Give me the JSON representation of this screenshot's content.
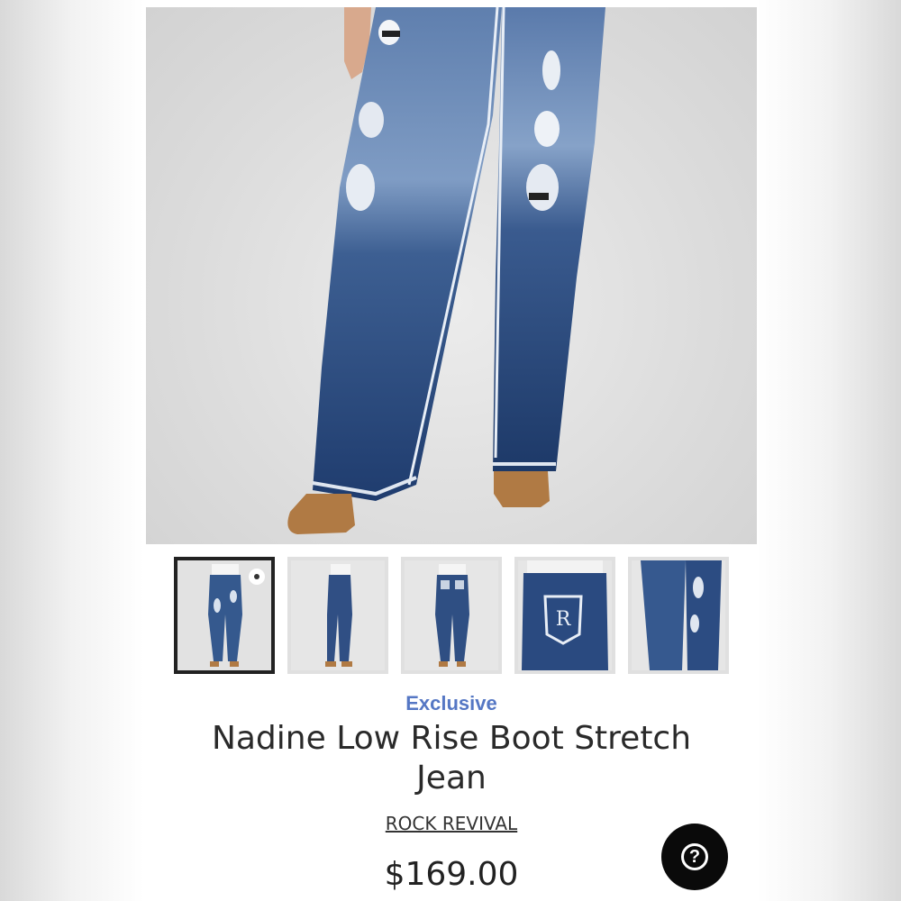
{
  "product": {
    "badge": "Exclusive",
    "title": "Nadine Low Rise Boot Stretch Jean",
    "brand": "ROCK REVIVAL",
    "price": "$169.00"
  },
  "gallery": {
    "main_image": "jeans-front-view-image",
    "selected_index": 0,
    "thumbnails": [
      {
        "view": "front-full"
      },
      {
        "view": "side-full"
      },
      {
        "view": "back-full"
      },
      {
        "view": "back-pocket-detail"
      },
      {
        "view": "leg-detail"
      }
    ]
  },
  "help": {
    "icon": "question-icon",
    "glyph": "?"
  },
  "colors": {
    "denim_dark": "#1f3c6e",
    "denim_mid": "#3d5f92",
    "denim_light": "#8fa7c6",
    "boot": "#b07a44",
    "accent_badge": "#5577c4",
    "help_bg": "#0a0a0a"
  }
}
